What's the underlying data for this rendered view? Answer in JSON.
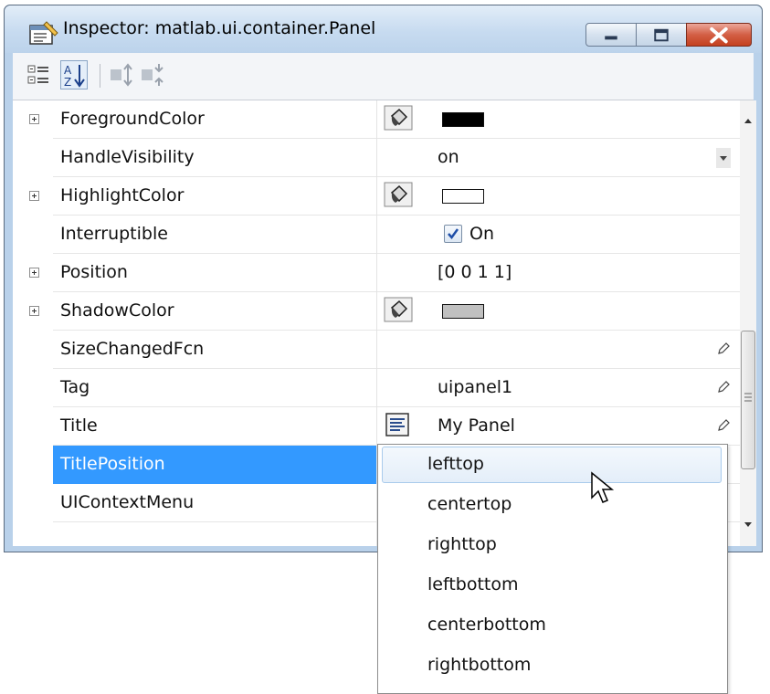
{
  "window": {
    "title": "Inspector:  matlab.ui.container.Panel"
  },
  "toolbar": {
    "buttons": [
      {
        "icon": "categorized-view-icon"
      },
      {
        "icon": "sort-alphabetical-icon",
        "active": true
      },
      {
        "icon": "expand-all-icon"
      },
      {
        "icon": "collapse-all-icon"
      }
    ]
  },
  "properties": [
    {
      "name": "ForegroundColor",
      "expandable": true,
      "kind": "color",
      "color": "#000000"
    },
    {
      "name": "HandleVisibility",
      "expandable": false,
      "kind": "dropdown",
      "value": "on"
    },
    {
      "name": "HighlightColor",
      "expandable": true,
      "kind": "color",
      "color": "#ffffff"
    },
    {
      "name": "Interruptible",
      "expandable": false,
      "kind": "checkbox",
      "checked": true,
      "value": "On"
    },
    {
      "name": "Position",
      "expandable": true,
      "kind": "text",
      "value": "[0 0 1 1]"
    },
    {
      "name": "ShadowColor",
      "expandable": true,
      "kind": "color",
      "color": "#c0c0c0"
    },
    {
      "name": "SizeChangedFcn",
      "expandable": false,
      "kind": "edit",
      "value": ""
    },
    {
      "name": "Tag",
      "expandable": false,
      "kind": "edit",
      "value": "uipanel1"
    },
    {
      "name": "Title",
      "expandable": false,
      "kind": "edit-multiline",
      "value": "My Panel"
    },
    {
      "name": "TitlePosition",
      "expandable": false,
      "kind": "dropdown-open",
      "selected": true
    },
    {
      "name": "UIContextMenu",
      "expandable": false,
      "kind": "text",
      "value": ""
    }
  ],
  "dropdown": {
    "options": [
      "lefttop",
      "centertop",
      "righttop",
      "leftbottom",
      "centerbottom",
      "rightbottom"
    ],
    "hovered": "lefttop"
  },
  "colors": {
    "selection": "#3399ff",
    "titlebar": "#c7dbf0"
  }
}
